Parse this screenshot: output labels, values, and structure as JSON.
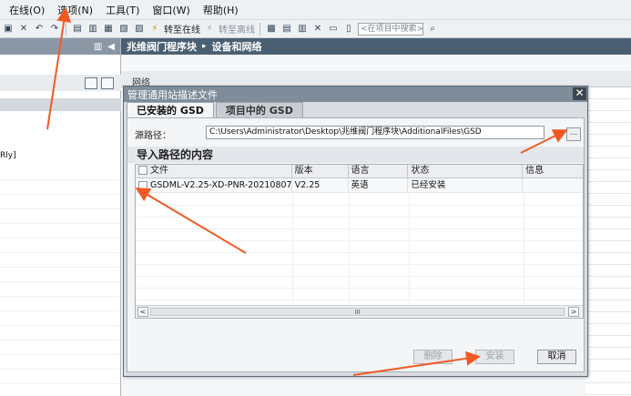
{
  "menu": {
    "items": [
      "在线(O)",
      "选项(N)",
      "工具(T)",
      "窗口(W)",
      "帮助(H)"
    ]
  },
  "toolbar": {
    "go_online": "转至在线",
    "go_offline": "转至离线",
    "search_placeholder": "<在项目中搜索>"
  },
  "left_pane": {
    "tree_fragment": "Rly]"
  },
  "breadcrumb": {
    "project": "兆维阀门程序块",
    "separator": "▸",
    "section": "设备和网络"
  },
  "editor": {
    "tab_fragment": "网络"
  },
  "dialog": {
    "title": "管理通用站描述文件",
    "close_symbol": "✕",
    "tabs": [
      {
        "label": "已安装的 GSD",
        "active": true
      },
      {
        "label": "项目中的 GSD",
        "active": false
      }
    ],
    "source_path_label": "源路径：",
    "source_path_value": "C:\\Users\\Administrator\\Desktop\\兆维阀门程序块\\AdditionalFiles\\GSD",
    "browse_label": "...",
    "section_title": "导入路径的内容",
    "columns": [
      "文件",
      "版本",
      "语言",
      "状态",
      "信息"
    ],
    "rows": [
      {
        "file": "GSDML-V2.25-XD-PNR-20210807....",
        "version": "V2.25",
        "language": "英语",
        "status": "已经安装",
        "info": ""
      }
    ],
    "scroll_thumb": "III",
    "scroll_left": "<",
    "scroll_right": ">",
    "buttons": {
      "delete": "删除",
      "install": "安装",
      "cancel": "取消"
    }
  },
  "colors": {
    "annotation_arrow": "#ef5a24",
    "breadcrumb_bg": "#4a6072",
    "dialog_title_bg": "#7f8c99"
  }
}
